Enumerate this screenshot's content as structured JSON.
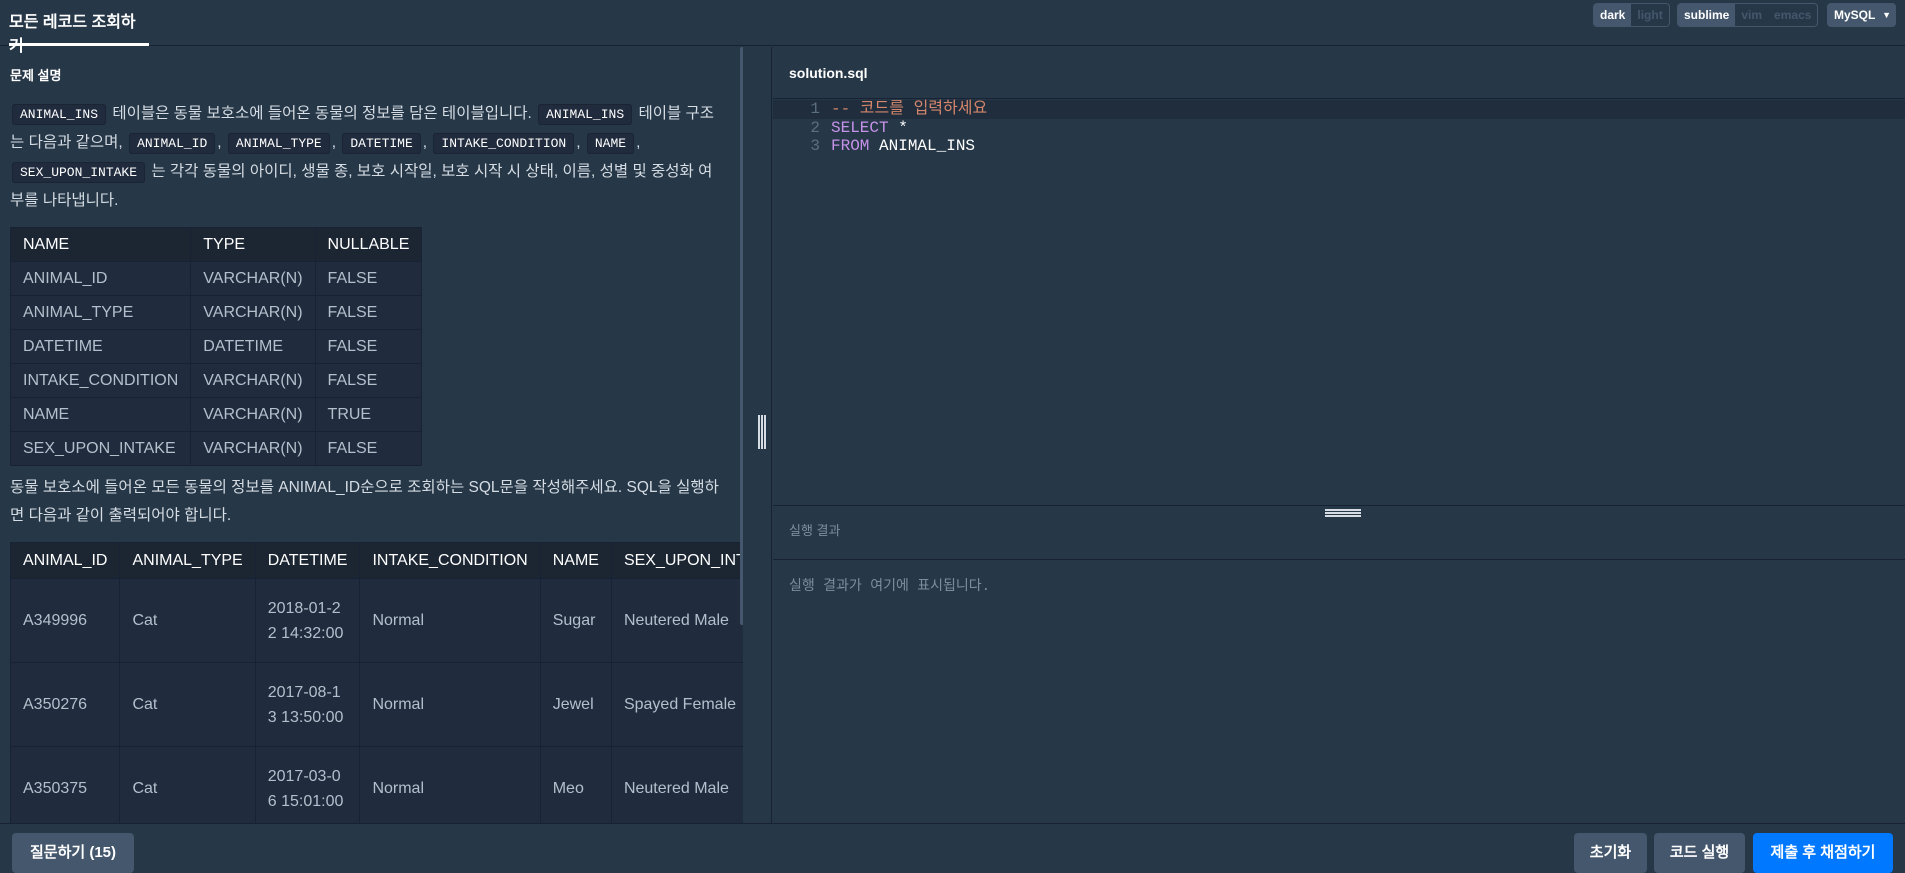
{
  "header": {
    "title": "모든 레코드 조회하기",
    "theme_options": [
      "dark",
      "light"
    ],
    "theme_selected": "dark",
    "editor_modes": [
      "sublime",
      "vim",
      "emacs"
    ],
    "editor_mode_selected": "sublime",
    "language": "MySQL"
  },
  "problem": {
    "section_title": "문제 설명",
    "intro": {
      "code_table": "ANIMAL_INS",
      "text1": "테이블은 동물 보호소에 들어온 동물의 정보를 담은 테이블입니다.",
      "code_table2": "ANIMAL_INS",
      "text2": "테이블 구조는 다음과 같으며,",
      "code_cols": [
        "ANIMAL_ID",
        "ANIMAL_TYPE",
        "DATETIME",
        "INTAKE_CONDITION",
        "NAME",
        "SEX_UPON_INTAKE"
      ],
      "text3": "는 각각 동물의 아이디, 생물 종, 보호 시작일, 보호 시작 시 상태, 이름, 성별 및 중성화 여부를 나타냅니다."
    },
    "schema_table": {
      "headers": [
        "NAME",
        "TYPE",
        "NULLABLE"
      ],
      "rows": [
        [
          "ANIMAL_ID",
          "VARCHAR(N)",
          "FALSE"
        ],
        [
          "ANIMAL_TYPE",
          "VARCHAR(N)",
          "FALSE"
        ],
        [
          "DATETIME",
          "DATETIME",
          "FALSE"
        ],
        [
          "INTAKE_CONDITION",
          "VARCHAR(N)",
          "FALSE"
        ],
        [
          "NAME",
          "VARCHAR(N)",
          "TRUE"
        ],
        [
          "SEX_UPON_INTAKE",
          "VARCHAR(N)",
          "FALSE"
        ]
      ]
    },
    "task": "동물 보호소에 들어온 모든 동물의 정보를 ANIMAL_ID순으로 조회하는 SQL문을 작성해주세요. SQL을 실행하면 다음과 같이 출력되어야 합니다.",
    "example_table": {
      "headers": [
        "ANIMAL_ID",
        "ANIMAL_TYPE",
        "DATETIME",
        "INTAKE_CONDITION",
        "NAME",
        "SEX_UPON_INTAKE"
      ],
      "rows": [
        [
          "A349996",
          "Cat",
          "2018-01-22 14:32:00",
          "Normal",
          "Sugar",
          "Neutered Male"
        ],
        [
          "A350276",
          "Cat",
          "2017-08-13 13:50:00",
          "Normal",
          "Jewel",
          "Spayed Female"
        ],
        [
          "A350375",
          "Cat",
          "2017-03-06 15:01:00",
          "Normal",
          "Meo",
          "Neutered Male"
        ]
      ]
    }
  },
  "editor": {
    "filename": "solution.sql",
    "lines": [
      {
        "num": "1",
        "parts": [
          {
            "cls": "comment",
            "text": "-- 코드를 입력하세요"
          }
        ]
      },
      {
        "num": "2",
        "parts": [
          {
            "cls": "kw",
            "text": "SELECT"
          },
          {
            "cls": "plain",
            "text": " *"
          }
        ]
      },
      {
        "num": "3",
        "parts": [
          {
            "cls": "kw",
            "text": "FROM"
          },
          {
            "cls": "plain",
            "text": " ANIMAL_INS"
          }
        ]
      }
    ]
  },
  "result": {
    "title": "실행 결과",
    "placeholder": "실행 결과가 여기에 표시됩니다."
  },
  "footer": {
    "ask_label": "질문하기 (15)",
    "reset_label": "초기화",
    "run_label": "코드 실행",
    "submit_label": "제출 후 채점하기"
  }
}
